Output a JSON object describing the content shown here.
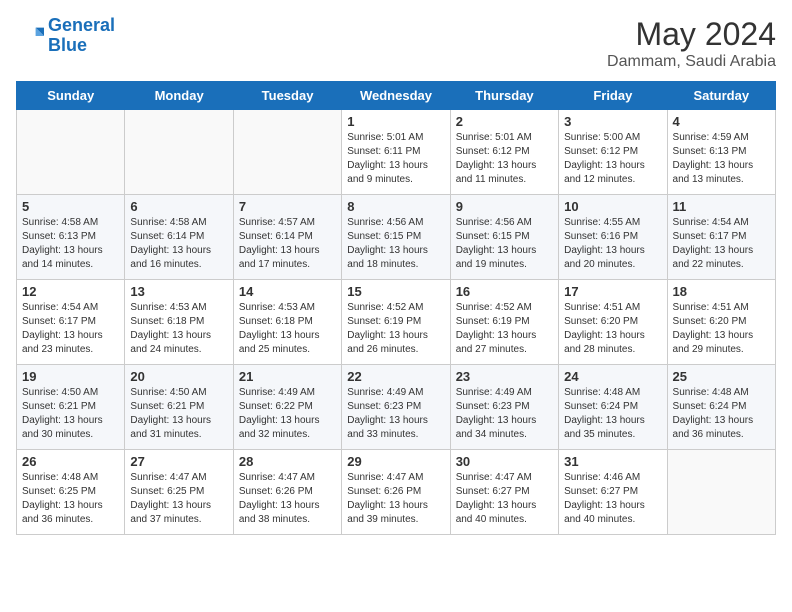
{
  "logo": {
    "text_general": "General",
    "text_blue": "Blue"
  },
  "header": {
    "title": "May 2024",
    "subtitle": "Dammam, Saudi Arabia"
  },
  "weekdays": [
    "Sunday",
    "Monday",
    "Tuesday",
    "Wednesday",
    "Thursday",
    "Friday",
    "Saturday"
  ],
  "weeks": [
    [
      {
        "day": "",
        "sunrise": "",
        "sunset": "",
        "daylight": ""
      },
      {
        "day": "",
        "sunrise": "",
        "sunset": "",
        "daylight": ""
      },
      {
        "day": "",
        "sunrise": "",
        "sunset": "",
        "daylight": ""
      },
      {
        "day": "1",
        "sunrise": "Sunrise: 5:01 AM",
        "sunset": "Sunset: 6:11 PM",
        "daylight": "Daylight: 13 hours and 9 minutes."
      },
      {
        "day": "2",
        "sunrise": "Sunrise: 5:01 AM",
        "sunset": "Sunset: 6:12 PM",
        "daylight": "Daylight: 13 hours and 11 minutes."
      },
      {
        "day": "3",
        "sunrise": "Sunrise: 5:00 AM",
        "sunset": "Sunset: 6:12 PM",
        "daylight": "Daylight: 13 hours and 12 minutes."
      },
      {
        "day": "4",
        "sunrise": "Sunrise: 4:59 AM",
        "sunset": "Sunset: 6:13 PM",
        "daylight": "Daylight: 13 hours and 13 minutes."
      }
    ],
    [
      {
        "day": "5",
        "sunrise": "Sunrise: 4:58 AM",
        "sunset": "Sunset: 6:13 PM",
        "daylight": "Daylight: 13 hours and 14 minutes."
      },
      {
        "day": "6",
        "sunrise": "Sunrise: 4:58 AM",
        "sunset": "Sunset: 6:14 PM",
        "daylight": "Daylight: 13 hours and 16 minutes."
      },
      {
        "day": "7",
        "sunrise": "Sunrise: 4:57 AM",
        "sunset": "Sunset: 6:14 PM",
        "daylight": "Daylight: 13 hours and 17 minutes."
      },
      {
        "day": "8",
        "sunrise": "Sunrise: 4:56 AM",
        "sunset": "Sunset: 6:15 PM",
        "daylight": "Daylight: 13 hours and 18 minutes."
      },
      {
        "day": "9",
        "sunrise": "Sunrise: 4:56 AM",
        "sunset": "Sunset: 6:15 PM",
        "daylight": "Daylight: 13 hours and 19 minutes."
      },
      {
        "day": "10",
        "sunrise": "Sunrise: 4:55 AM",
        "sunset": "Sunset: 6:16 PM",
        "daylight": "Daylight: 13 hours and 20 minutes."
      },
      {
        "day": "11",
        "sunrise": "Sunrise: 4:54 AM",
        "sunset": "Sunset: 6:17 PM",
        "daylight": "Daylight: 13 hours and 22 minutes."
      }
    ],
    [
      {
        "day": "12",
        "sunrise": "Sunrise: 4:54 AM",
        "sunset": "Sunset: 6:17 PM",
        "daylight": "Daylight: 13 hours and 23 minutes."
      },
      {
        "day": "13",
        "sunrise": "Sunrise: 4:53 AM",
        "sunset": "Sunset: 6:18 PM",
        "daylight": "Daylight: 13 hours and 24 minutes."
      },
      {
        "day": "14",
        "sunrise": "Sunrise: 4:53 AM",
        "sunset": "Sunset: 6:18 PM",
        "daylight": "Daylight: 13 hours and 25 minutes."
      },
      {
        "day": "15",
        "sunrise": "Sunrise: 4:52 AM",
        "sunset": "Sunset: 6:19 PM",
        "daylight": "Daylight: 13 hours and 26 minutes."
      },
      {
        "day": "16",
        "sunrise": "Sunrise: 4:52 AM",
        "sunset": "Sunset: 6:19 PM",
        "daylight": "Daylight: 13 hours and 27 minutes."
      },
      {
        "day": "17",
        "sunrise": "Sunrise: 4:51 AM",
        "sunset": "Sunset: 6:20 PM",
        "daylight": "Daylight: 13 hours and 28 minutes."
      },
      {
        "day": "18",
        "sunrise": "Sunrise: 4:51 AM",
        "sunset": "Sunset: 6:20 PM",
        "daylight": "Daylight: 13 hours and 29 minutes."
      }
    ],
    [
      {
        "day": "19",
        "sunrise": "Sunrise: 4:50 AM",
        "sunset": "Sunset: 6:21 PM",
        "daylight": "Daylight: 13 hours and 30 minutes."
      },
      {
        "day": "20",
        "sunrise": "Sunrise: 4:50 AM",
        "sunset": "Sunset: 6:21 PM",
        "daylight": "Daylight: 13 hours and 31 minutes."
      },
      {
        "day": "21",
        "sunrise": "Sunrise: 4:49 AM",
        "sunset": "Sunset: 6:22 PM",
        "daylight": "Daylight: 13 hours and 32 minutes."
      },
      {
        "day": "22",
        "sunrise": "Sunrise: 4:49 AM",
        "sunset": "Sunset: 6:23 PM",
        "daylight": "Daylight: 13 hours and 33 minutes."
      },
      {
        "day": "23",
        "sunrise": "Sunrise: 4:49 AM",
        "sunset": "Sunset: 6:23 PM",
        "daylight": "Daylight: 13 hours and 34 minutes."
      },
      {
        "day": "24",
        "sunrise": "Sunrise: 4:48 AM",
        "sunset": "Sunset: 6:24 PM",
        "daylight": "Daylight: 13 hours and 35 minutes."
      },
      {
        "day": "25",
        "sunrise": "Sunrise: 4:48 AM",
        "sunset": "Sunset: 6:24 PM",
        "daylight": "Daylight: 13 hours and 36 minutes."
      }
    ],
    [
      {
        "day": "26",
        "sunrise": "Sunrise: 4:48 AM",
        "sunset": "Sunset: 6:25 PM",
        "daylight": "Daylight: 13 hours and 36 minutes."
      },
      {
        "day": "27",
        "sunrise": "Sunrise: 4:47 AM",
        "sunset": "Sunset: 6:25 PM",
        "daylight": "Daylight: 13 hours and 37 minutes."
      },
      {
        "day": "28",
        "sunrise": "Sunrise: 4:47 AM",
        "sunset": "Sunset: 6:26 PM",
        "daylight": "Daylight: 13 hours and 38 minutes."
      },
      {
        "day": "29",
        "sunrise": "Sunrise: 4:47 AM",
        "sunset": "Sunset: 6:26 PM",
        "daylight": "Daylight: 13 hours and 39 minutes."
      },
      {
        "day": "30",
        "sunrise": "Sunrise: 4:47 AM",
        "sunset": "Sunset: 6:27 PM",
        "daylight": "Daylight: 13 hours and 40 minutes."
      },
      {
        "day": "31",
        "sunrise": "Sunrise: 4:46 AM",
        "sunset": "Sunset: 6:27 PM",
        "daylight": "Daylight: 13 hours and 40 minutes."
      },
      {
        "day": "",
        "sunrise": "",
        "sunset": "",
        "daylight": ""
      }
    ]
  ]
}
